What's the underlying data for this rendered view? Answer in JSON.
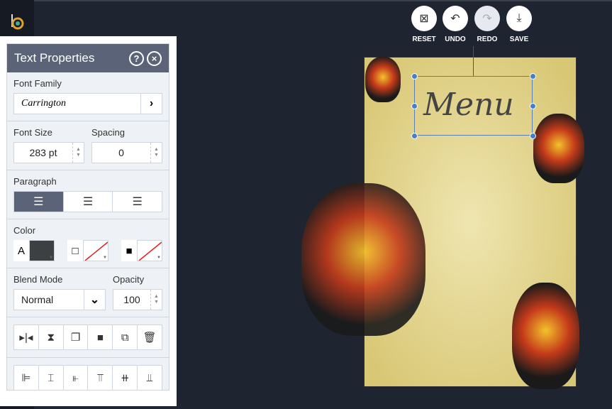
{
  "panel": {
    "title": "Text Properties",
    "help": "?",
    "close": "×",
    "font_family": {
      "label": "Font Family",
      "value": "Carrington"
    },
    "font_size": {
      "label": "Font Size",
      "value": "283 pt"
    },
    "spacing": {
      "label": "Spacing",
      "value": "0"
    },
    "paragraph": {
      "label": "Paragraph",
      "selected": "left"
    },
    "color": {
      "label": "Color",
      "text_glyph": "A",
      "text_color": "#3d4043"
    },
    "blend": {
      "label": "Blend Mode",
      "value": "Normal"
    },
    "opacity": {
      "label": "Opacity",
      "value": "100"
    }
  },
  "toolbar": {
    "reset": "RESET",
    "undo": "UNDO",
    "redo": "REDO",
    "save": "SAVE"
  },
  "canvas": {
    "text": "Menu"
  }
}
